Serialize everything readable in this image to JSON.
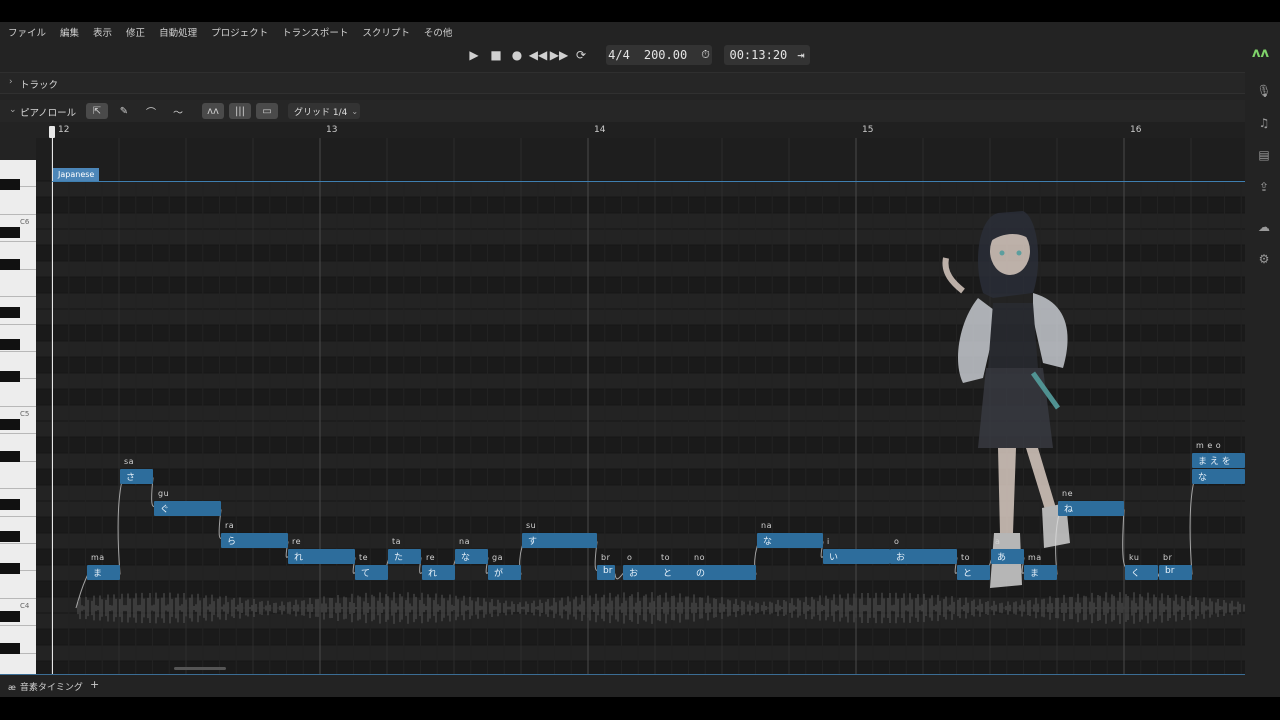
{
  "menu": [
    "ファイル",
    "編集",
    "表示",
    "修正",
    "自動処理",
    "プロジェクト",
    "トランスポート",
    "スクリプト",
    "その他"
  ],
  "transport": {
    "time_signature": "4/4",
    "tempo": "200.00",
    "time": "00:13:20"
  },
  "track_panel": {
    "label": "トラック"
  },
  "piano_roll": {
    "label": "ピアノロール",
    "grid": "グリッド 1/4",
    "language_tag": "Japanese"
  },
  "ruler": [
    "12",
    "13",
    "14",
    "15",
    "16"
  ],
  "keys": [
    "C6",
    "C5",
    "C4"
  ],
  "notes": [
    {
      "ph": "ma",
      "ly": "ま"
    },
    {
      "ph": "sa",
      "ly": "さ"
    },
    {
      "ph": "gu",
      "ly": "ぐ"
    },
    {
      "ph": "ra",
      "ly": "ら"
    },
    {
      "ph": "re",
      "ly": "れ"
    },
    {
      "ph": "te",
      "ly": "て"
    },
    {
      "ph": "ta",
      "ly": "た"
    },
    {
      "ph": "re",
      "ly": "れ"
    },
    {
      "ph": "na",
      "ly": "な"
    },
    {
      "ph": "ga",
      "ly": "が"
    },
    {
      "ph": "su",
      "ly": "す"
    },
    {
      "ph": "br",
      "ly": "br"
    },
    {
      "ph": "o",
      "ly": "お"
    },
    {
      "ph": "to",
      "ly": "と"
    },
    {
      "ph": "no",
      "ly": "の"
    },
    {
      "ph": "na",
      "ly": "な"
    },
    {
      "ph": "i",
      "ly": "い"
    },
    {
      "ph": "o",
      "ly": "お"
    },
    {
      "ph": "to",
      "ly": "と"
    },
    {
      "ph": "a",
      "ly": "あ"
    },
    {
      "ph": "ma",
      "ly": "ま"
    },
    {
      "ph": "ne",
      "ly": "ね"
    },
    {
      "ph": "ku",
      "ly": "く"
    },
    {
      "ph": "br",
      "ly": "br"
    },
    {
      "ph": "na",
      "ly": "な"
    },
    {
      "ph": "m e o",
      "ly": "ま え を"
    }
  ],
  "bottom_panel": {
    "label": "音素タイミング",
    "add": "+"
  },
  "colors": {
    "note": "#2d6d9c",
    "accent": "#3b6d94",
    "background": "#1e1e1e"
  }
}
